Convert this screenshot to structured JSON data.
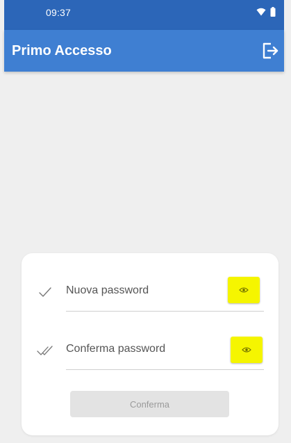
{
  "status_bar": {
    "time": "09:37",
    "icons": [
      "wifi-icon",
      "battery-icon"
    ]
  },
  "app_bar": {
    "title": "Primo Accesso",
    "action_icon": "logout-icon"
  },
  "form": {
    "new_password": {
      "placeholder": "Nuova password",
      "value": "",
      "icon": "check-icon",
      "toggle_icon": "eye-icon"
    },
    "confirm_password": {
      "placeholder": "Conferma password",
      "value": "",
      "icon": "double-check-icon",
      "toggle_icon": "eye-icon"
    },
    "submit_label": "Conferma"
  },
  "colors": {
    "status_bar": "#2c66b8",
    "app_bar": "#3f7fd2",
    "background": "#efefef",
    "highlight": "#f5f500",
    "button_disabled": "#e3e3e3"
  }
}
